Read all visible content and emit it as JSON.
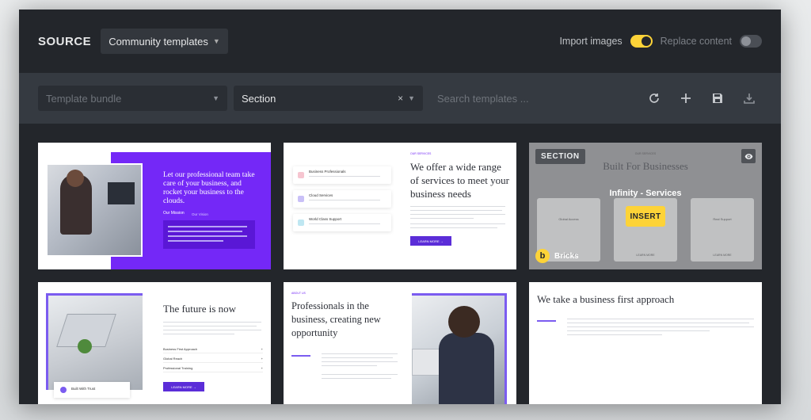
{
  "header": {
    "source_label": "SOURCE",
    "source_select": "Community templates",
    "import_images_label": "Import images",
    "import_images_on": true,
    "replace_content_label": "Replace content",
    "replace_content_on": false
  },
  "filters": {
    "bundle_placeholder": "Template bundle",
    "type_value": "Section",
    "clear_icon": "×",
    "search_placeholder": "Search templates ..."
  },
  "toolbar": {
    "icons": [
      "refresh-icon",
      "plus-icon",
      "save-icon",
      "download-icon"
    ]
  },
  "cards": {
    "c1": {
      "heading": "Let our professional team take care of your business, and rocket your business to the clouds.",
      "tab1": "Our Mission",
      "tab2": "Our Vision"
    },
    "c2": {
      "kicker": "OUR SERVICES",
      "heading": "We offer a wide range of services to meet your business needs",
      "items": [
        "Business Professionals",
        "Cloud Services",
        "World Class Support"
      ],
      "button": "LEARN MORE →"
    },
    "c3": {
      "badge": "SECTION",
      "kicker": "OUR SERVICES",
      "heading": "Built For Businesses",
      "name": "Infinity - Services",
      "insert": "INSERT",
      "author": "Bricks",
      "author_logo": "b",
      "columns": [
        "Global Access",
        "Grow Your Business",
        "Real Support"
      ],
      "col_link": "LEARN MORE"
    },
    "c4": {
      "heading": "The future is now",
      "list": [
        "Business First Approach",
        "Global Reach",
        "Professional Training"
      ],
      "list_mark": "+",
      "button": "LEARN MORE →",
      "tag": "Built With Trust"
    },
    "c5": {
      "kicker": "ABOUT US",
      "heading": "Professionals in the business, creating new opportunity"
    },
    "c6": {
      "heading": "We take a business first approach"
    }
  }
}
